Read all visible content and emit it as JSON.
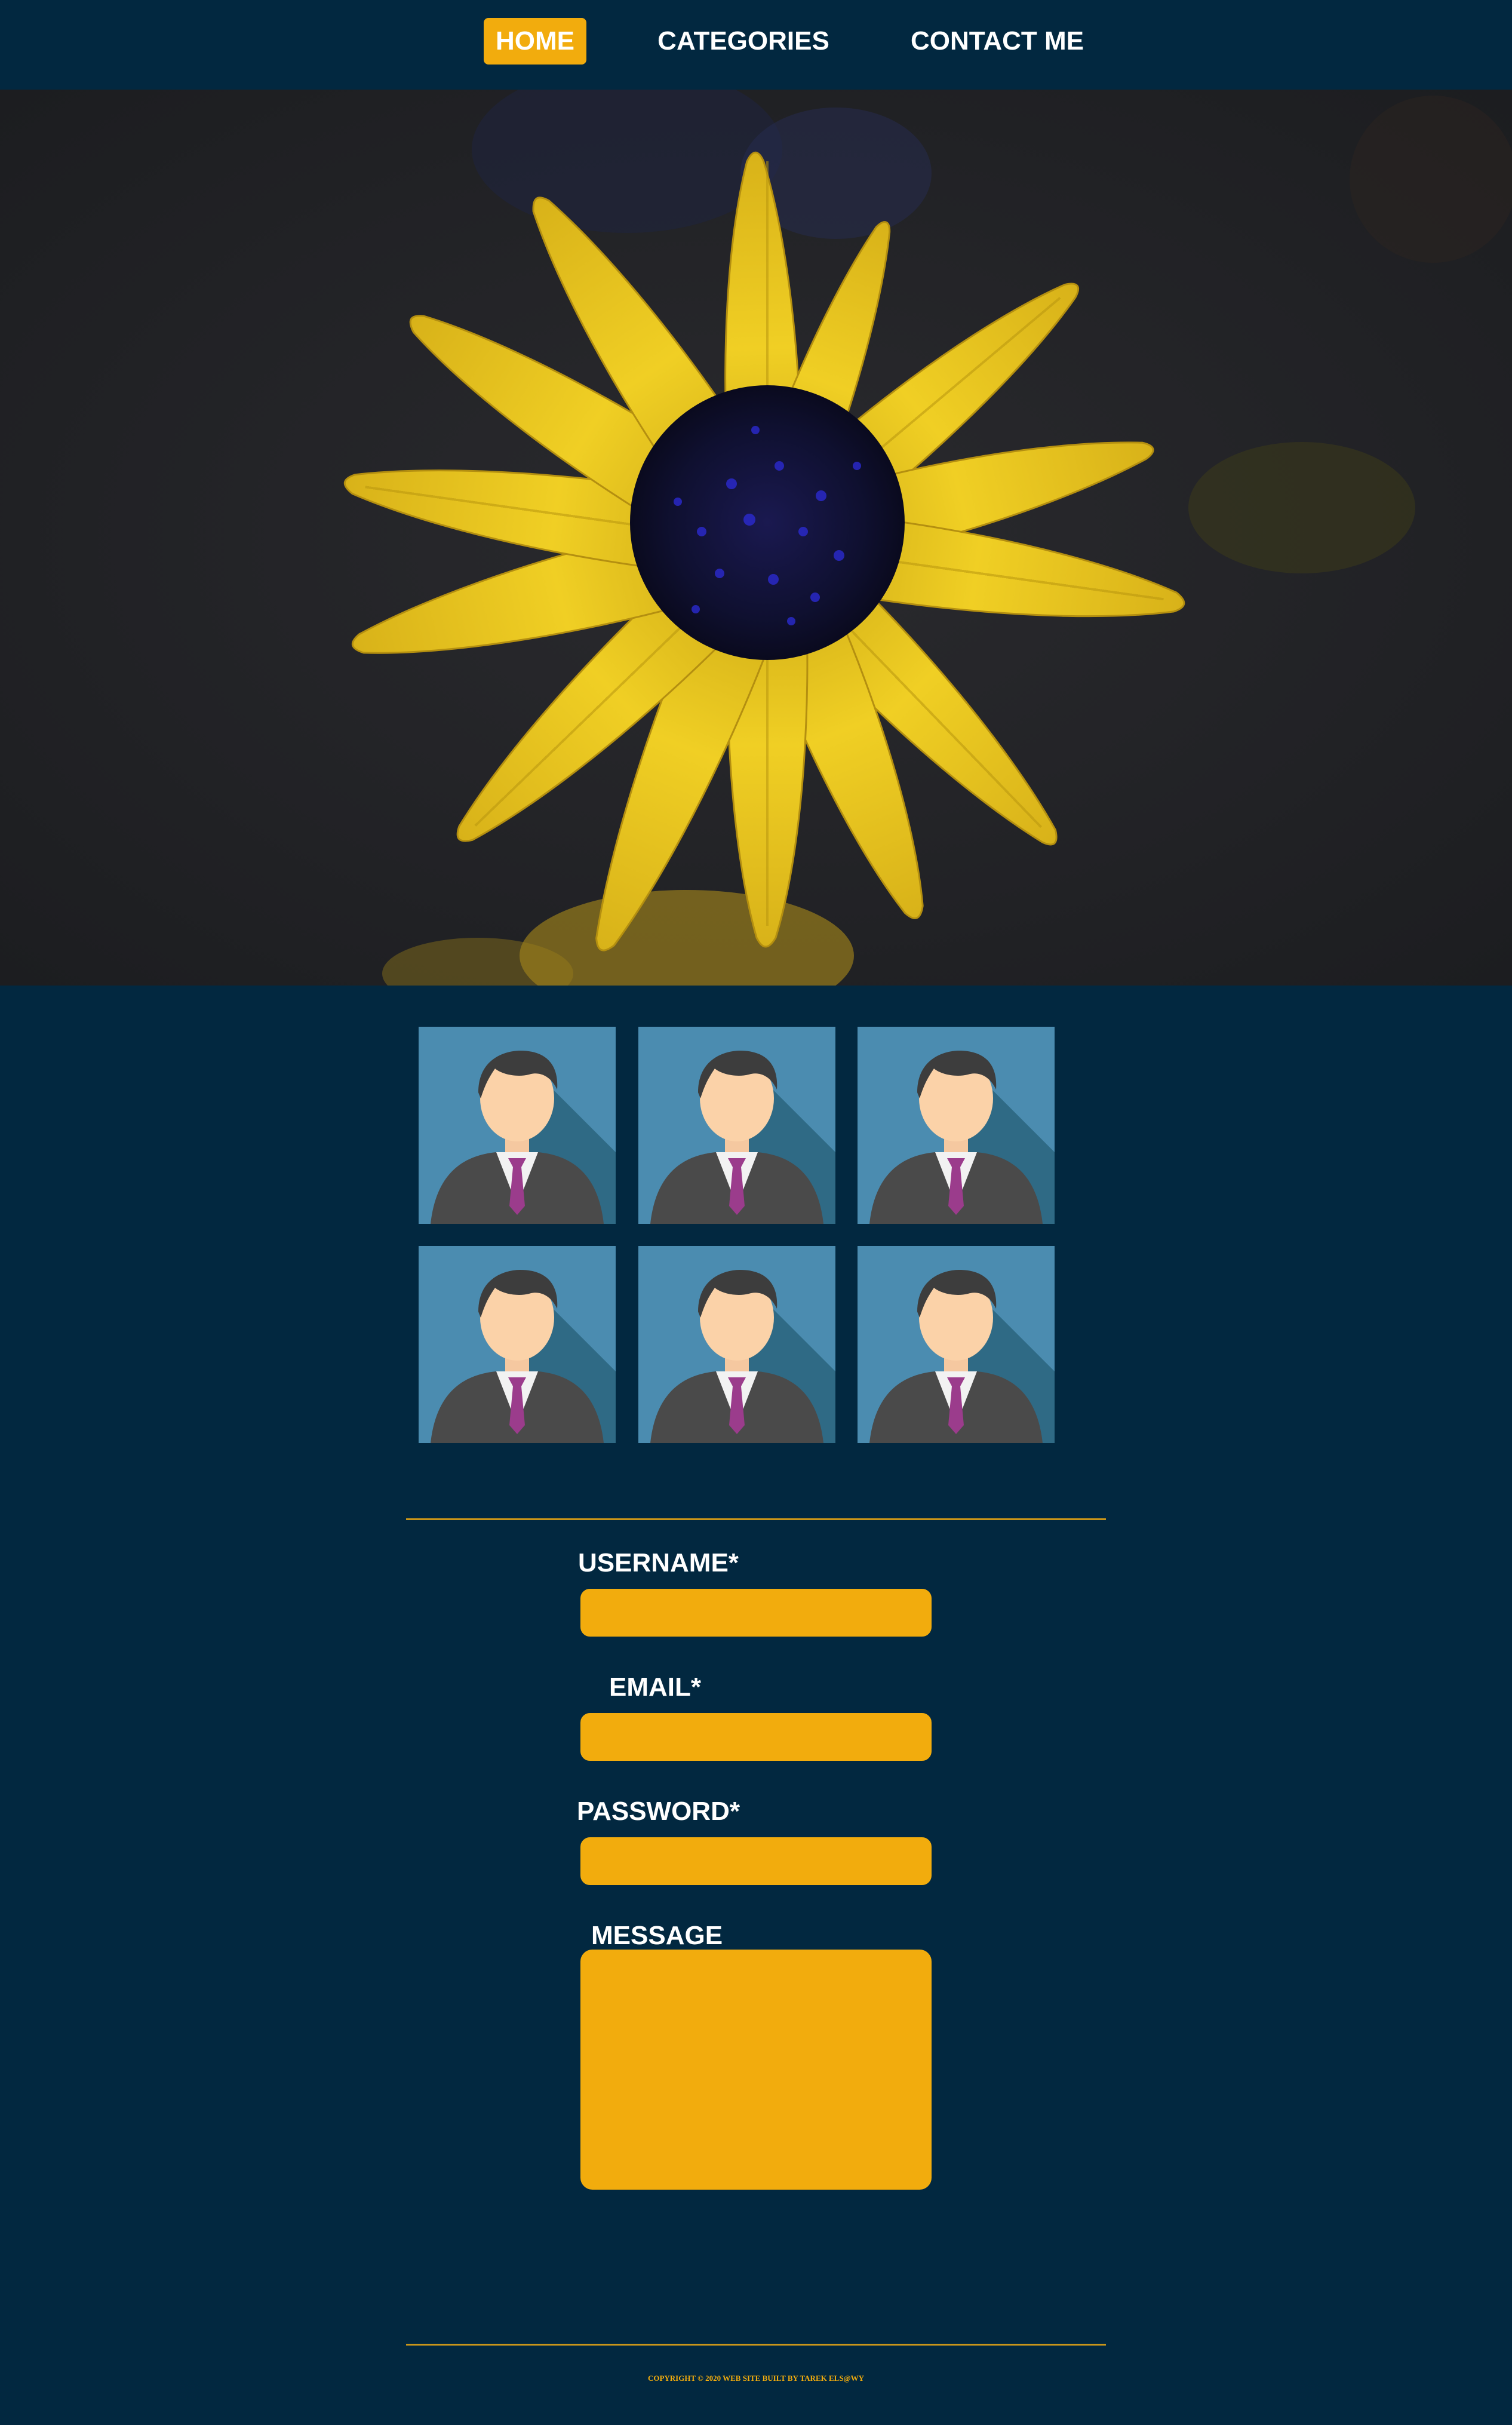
{
  "nav": {
    "items": [
      {
        "label": "HOME",
        "active": true
      },
      {
        "label": "CATEGORIES",
        "active": false
      },
      {
        "label": "CONTACT ME",
        "active": false
      }
    ]
  },
  "hero": {
    "image": "yellow-flower-photo"
  },
  "gallery": {
    "tiles": [
      "avatar-icon",
      "avatar-icon",
      "avatar-icon",
      "avatar-icon",
      "avatar-icon",
      "avatar-icon"
    ]
  },
  "form": {
    "username_label": "USERNAME*",
    "username_value": "",
    "email_label": "EMAIL*",
    "email_value": "",
    "password_label": "PASSWORD*",
    "password_value": "",
    "message_label": "MESSAGE",
    "message_value": ""
  },
  "footer": {
    "copyright": "COPYRIGHT © 2020 WEB SITE BUILT BY TAREK ELS@WY"
  },
  "colors": {
    "background": "#022840",
    "accent": "#f2ac0d",
    "text": "#ffffff"
  }
}
